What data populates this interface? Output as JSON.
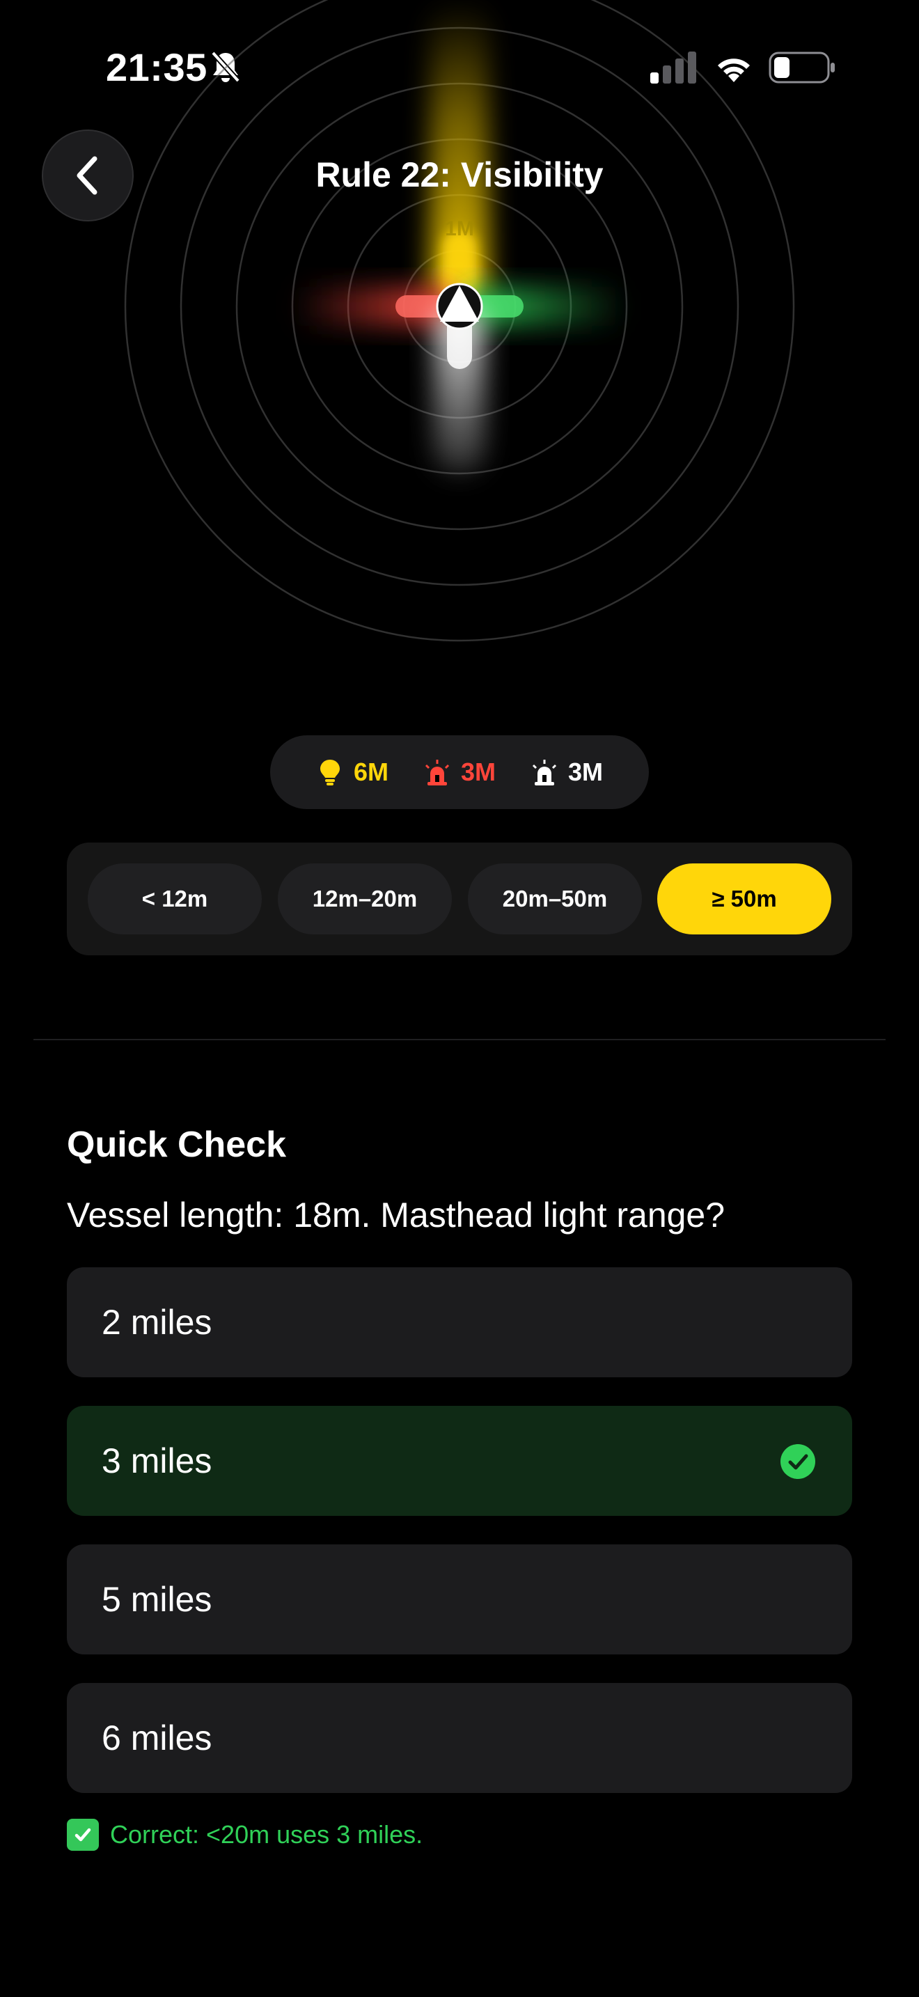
{
  "status_bar": {
    "time": "21:35"
  },
  "header": {
    "title": "Rule 22: Visibility",
    "back_icon": "chevron-left-icon"
  },
  "visualization": {
    "top_label": "1M"
  },
  "legend": {
    "masthead": {
      "label": "6M",
      "icon": "lightbulb-icon",
      "color": "#ffd60a"
    },
    "sidelights": {
      "label": "3M",
      "icon": "red-beacon-icon",
      "color": "#ff453a"
    },
    "stern": {
      "label": "3M",
      "icon": "white-beacon-icon",
      "color": "#ffffff"
    }
  },
  "length_selector": {
    "options": [
      "< 12m",
      "12m–20m",
      "20m–50m",
      "≥ 50m"
    ],
    "selected": "≥ 50m",
    "accent": "#ffd60a"
  },
  "quick_check": {
    "heading": "Quick Check",
    "question": "Vessel length: 18m. Masthead light range?",
    "options": [
      "2 miles",
      "3 miles",
      "5 miles",
      "6 miles"
    ],
    "correct_option": "3 miles",
    "feedback": "Correct: <20m uses 3 miles."
  },
  "colors": {
    "correct_bg": "#0f2a15",
    "correct_green": "#30d158"
  }
}
